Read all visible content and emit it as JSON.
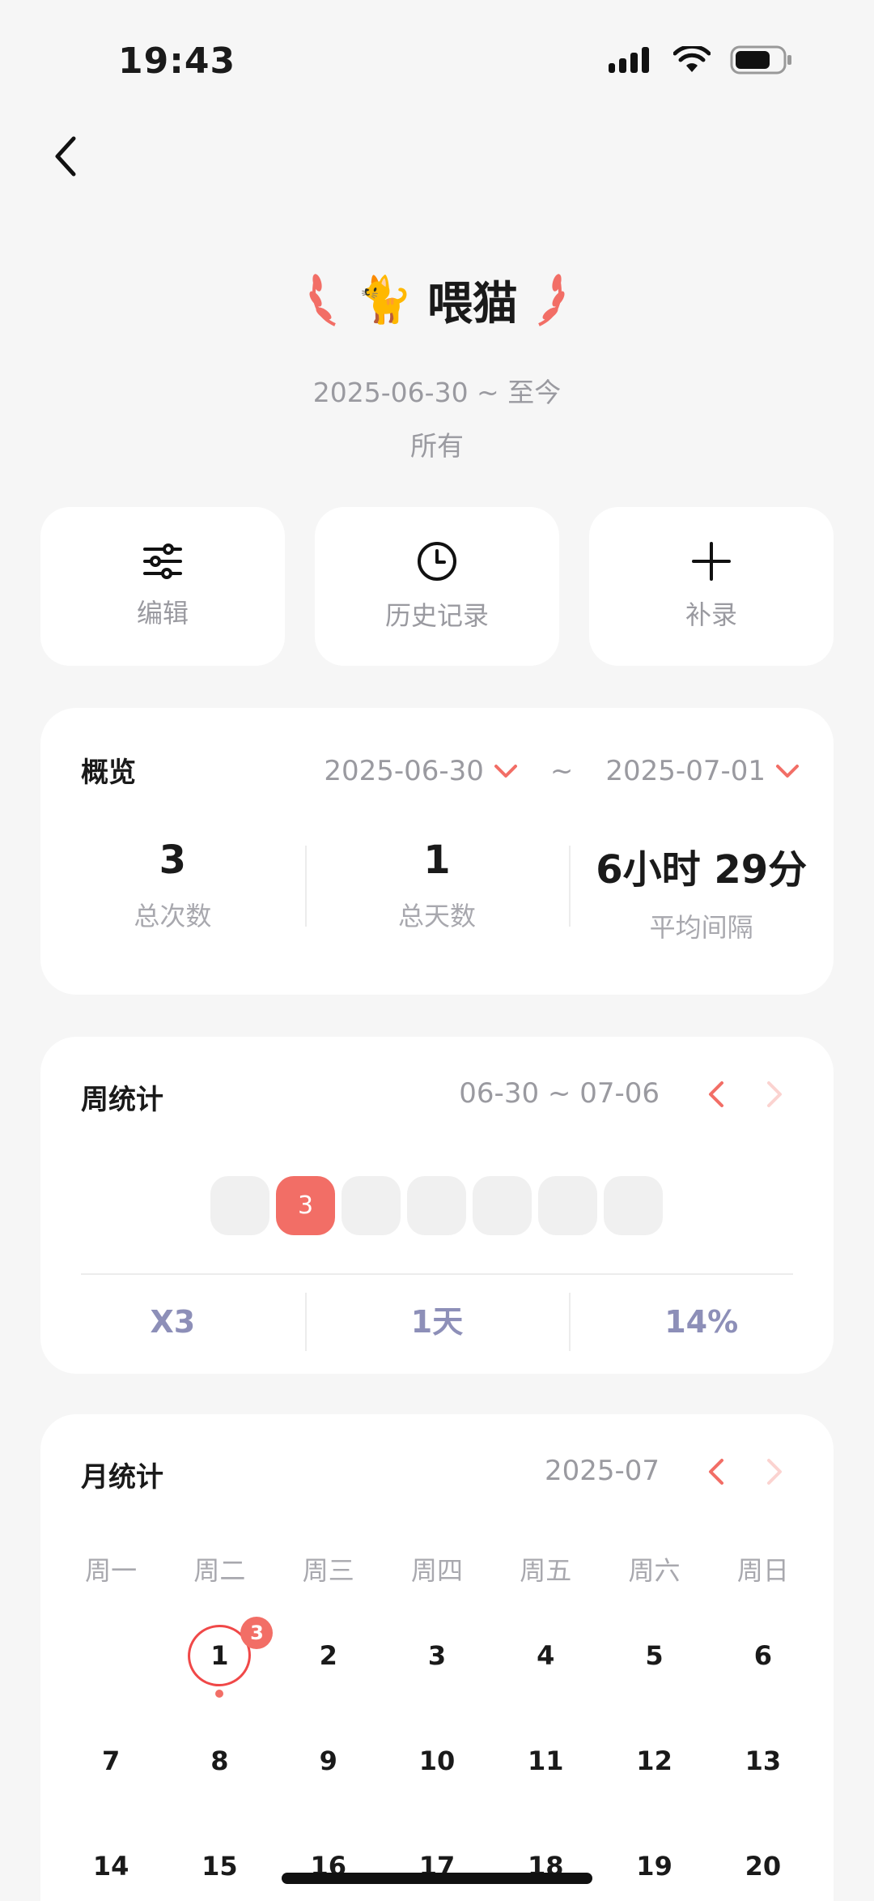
{
  "status_bar": {
    "time": "19:43"
  },
  "header": {
    "emoji": "🐈",
    "title": "喂猫",
    "date_range": "2025-06-30 ~ 至今",
    "scope": "所有"
  },
  "actions": [
    {
      "label": "编辑",
      "icon": "sliders-icon"
    },
    {
      "label": "历史记录",
      "icon": "clock-icon"
    },
    {
      "label": "补录",
      "icon": "plus-icon"
    }
  ],
  "overview": {
    "title": "概览",
    "start_date": "2025-06-30",
    "tilde": "~",
    "end_date": "2025-07-01",
    "stats": [
      {
        "value": "3",
        "label": "总次数"
      },
      {
        "value": "1",
        "label": "总天数"
      },
      {
        "value": "6小时 29分",
        "label": "平均间隔"
      }
    ]
  },
  "week": {
    "title": "周统计",
    "range": "06-30 ~ 07-06",
    "days": [
      "",
      "3",
      "",
      "",
      "",
      "",
      ""
    ],
    "stats": [
      "X3",
      "1天",
      "14%"
    ]
  },
  "month": {
    "title": "月统计",
    "label": "2025-07",
    "weekdays": [
      "周一",
      "周二",
      "周三",
      "周四",
      "周五",
      "周六",
      "周日"
    ],
    "days": [
      "",
      "1",
      "2",
      "3",
      "4",
      "5",
      "6",
      "7",
      "8",
      "9",
      "10",
      "11",
      "12",
      "13",
      "14",
      "15",
      "16",
      "17",
      "18",
      "19",
      "20"
    ],
    "today_badge": "3"
  },
  "colors": {
    "accent": "#f26e66",
    "muted": "#9a9aa0",
    "stat_blue": "#8d8fb8"
  }
}
